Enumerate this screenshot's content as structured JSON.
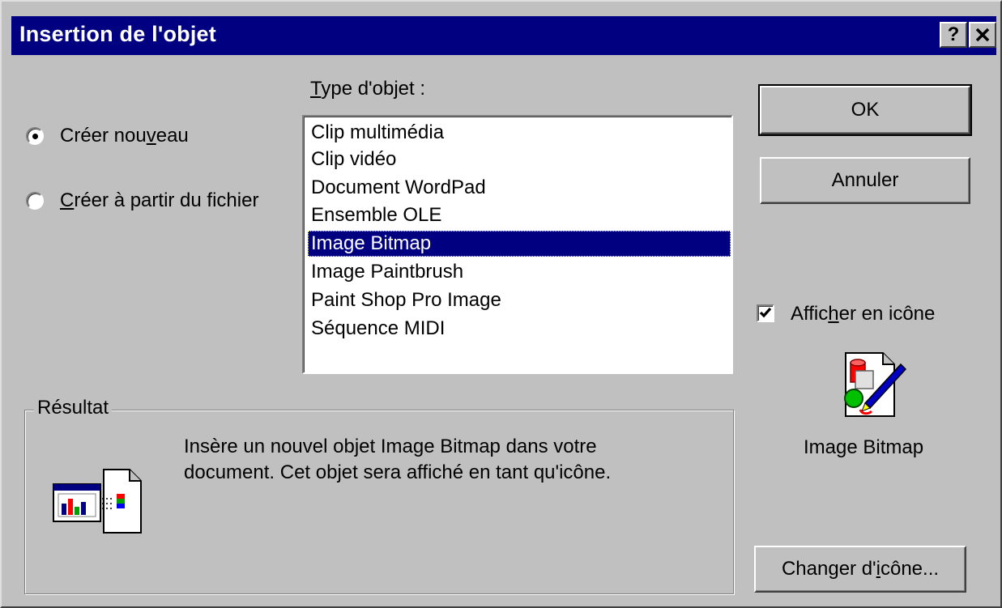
{
  "window": {
    "title": "Insertion de l'objet",
    "help_label": "?",
    "close_label": "✕"
  },
  "options": {
    "create_new": {
      "label_before": "Créer nou",
      "label_underline": "v",
      "label_after": "eau",
      "selected": true
    },
    "create_from_file": {
      "label_before": "",
      "label_underline": "C",
      "label_after": "réer à partir du fichier",
      "selected": false
    }
  },
  "object_type": {
    "label_underline": "T",
    "label_after": "ype d'objet :",
    "items": [
      "Clip multimédia",
      "Clip vidéo",
      "Document WordPad",
      "Ensemble OLE",
      "Image Bitmap",
      "Image Paintbrush",
      "Paint Shop Pro Image",
      "Séquence MIDI"
    ],
    "selected_item": "Image Bitmap"
  },
  "buttons": {
    "ok": "OK",
    "cancel": "Annuler",
    "change_icon_before": "Changer d'",
    "change_icon_underline": "i",
    "change_icon_after": "cône..."
  },
  "display_as_icon": {
    "label_before": "Affic",
    "label_underline": "h",
    "label_after": "er en icône",
    "checked": true,
    "checkmark": "✔"
  },
  "icon_preview": {
    "icon": "paint-bitmap-icon",
    "caption": "Image Bitmap"
  },
  "result": {
    "title": "Résultat",
    "line1": "Insère un nouvel objet Image Bitmap dans votre",
    "line2": "document. Cet objet sera affiché en tant qu'icône.",
    "icon": "embedded-object-icon"
  },
  "colors": {
    "titlebar": "#000080",
    "face": "#c0c0c0",
    "selection": "#000080"
  }
}
